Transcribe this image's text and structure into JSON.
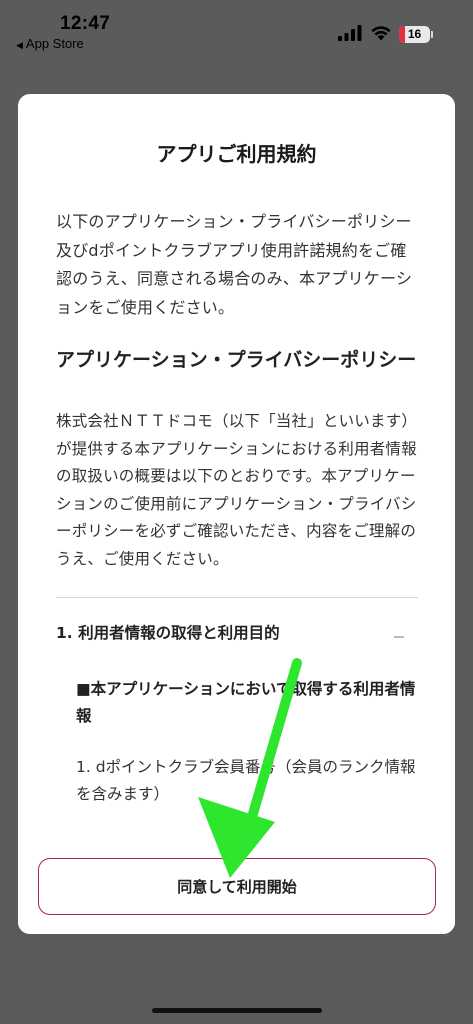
{
  "status_bar": {
    "time": "12:47",
    "back_app": "App Store",
    "battery_level": "16",
    "battery_color": "#e0323c"
  },
  "modal": {
    "title": "アプリご利用規約",
    "intro": "以下のアプリケーション・プライバシーポリシー及びdポイントクラブアプリ使用許諾規約をご確認のうえ、同意される場合のみ、本アプリケーションをご使用ください。",
    "section_heading": "アプリケーション・プライバシーポリシー",
    "section_body": "株式会社ＮＴＴドコモ（以下「当社」といいます）が提供する本アプリケーションにおける利用者情報の取扱いの概要は以下のとおりです。本アプリケーションのご使用前にアプリケーション・プライバシーポリシーを必ずご確認いただき、内容をご理解のうえ、ご使用ください。",
    "accordion": {
      "title": "1. 利用者情報の取得と利用目的",
      "expanded": true,
      "sub_heading": "■本アプリケーションにおいて取得する利用者情報",
      "items": [
        "1.  dポイントクラブ会員番号（会員のランク情報を含みます）"
      ]
    },
    "agree_button": "同意して利用開始",
    "agree_button_border_color": "#a8264a"
  },
  "overlay": {
    "arrow_icon": "green-arrow-icon",
    "arrow_color": "#2ee62e"
  }
}
